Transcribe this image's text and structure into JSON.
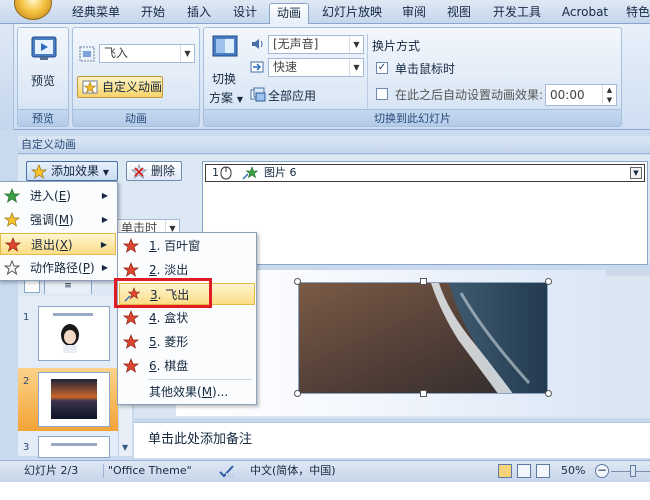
{
  "tabs": [
    "经典菜单",
    "开始",
    "插入",
    "设计",
    "动画",
    "幻灯片放映",
    "审阅",
    "视图",
    "开发工具",
    "Acrobat",
    "特色"
  ],
  "active_tab": "动画",
  "ribbon": {
    "preview": {
      "button": "预览",
      "group": "预览"
    },
    "animation": {
      "anim_select": "飞入",
      "custom_button": "自定义动画",
      "group": "动画"
    },
    "transition": {
      "switch_label_1": "切换",
      "switch_label_2": "方案",
      "sound": "[无声音]",
      "speed": "快速",
      "apply_all": "全部应用",
      "advance_title": "换片方式",
      "on_click": "单击鼠标时",
      "after_auto": "在此之后自动设置动画效果:",
      "time": "00:00",
      "group": "切换到此幻灯片"
    }
  },
  "panel": {
    "title": "自定义动画",
    "add_effect": "添加效果",
    "delete": "删除",
    "start_value": "单击时",
    "anim_item_num": "1",
    "anim_item_name": "图片 6"
  },
  "menu": {
    "items": [
      {
        "label": "进入(E)",
        "label_pre": "进入(",
        "key": "E",
        "label_post": ")"
      },
      {
        "label": "强调(M)",
        "label_pre": "强调(",
        "key": "M",
        "label_post": ")"
      },
      {
        "label": "退出(X)",
        "label_pre": "退出(",
        "key": "X",
        "label_post": ")"
      },
      {
        "label": "动作路径(P)",
        "label_pre": "动作路径(",
        "key": "P",
        "label_post": ")"
      }
    ],
    "highlighted": "退出(X)"
  },
  "submenu": {
    "items": [
      {
        "num": "1",
        "label": ". 百叶窗"
      },
      {
        "num": "2",
        "label": ". 淡出"
      },
      {
        "num": "3",
        "label": ". 飞出"
      },
      {
        "num": "4",
        "label": ". 盒状"
      },
      {
        "num": "5",
        "label": ". 菱形"
      },
      {
        "num": "6",
        "label": ". 棋盘"
      }
    ],
    "highlighted": "3. 飞出",
    "more_pre": "其他效果(",
    "more_key": "M",
    "more_post": ")..."
  },
  "thumbnails": {
    "numbers": [
      "1",
      "2",
      "3"
    ],
    "selected": "2"
  },
  "notes_placeholder": "单击此处添加备注",
  "status": {
    "slide": "幻灯片 2/3",
    "theme": "\"Office Theme\"",
    "language": "中文(简体，中国)",
    "zoom": "50%"
  },
  "colors": {
    "highlight_box": "#e01b24",
    "menu_highlight": "#fbdd85",
    "ribbon_bg": "#dbe7f5"
  }
}
